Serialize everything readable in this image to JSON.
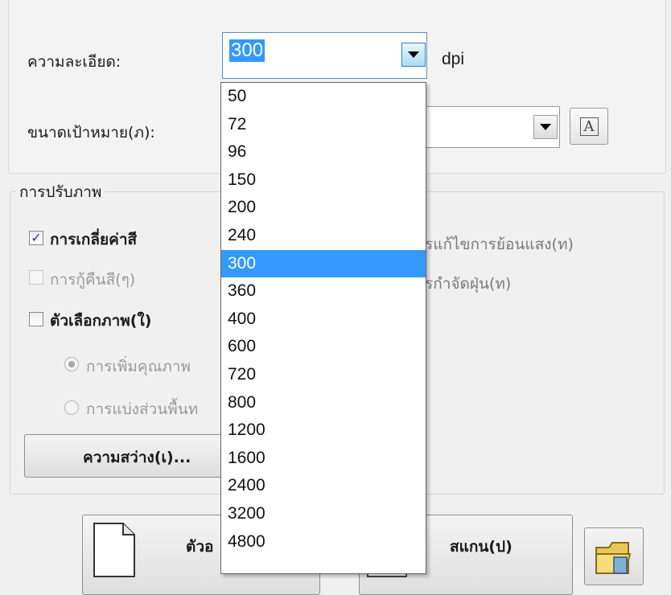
{
  "resolution": {
    "label": "ความละเอียด:",
    "value": "300",
    "unit": "dpi",
    "options": [
      "50",
      "72",
      "96",
      "150",
      "200",
      "240",
      "300",
      "360",
      "400",
      "600",
      "720",
      "800",
      "1200",
      "1600",
      "2400",
      "3200",
      "4800"
    ],
    "selected_option": "300"
  },
  "target_size": {
    "label": "ขนาดเป้าหมาย(ภ):",
    "value": "",
    "font_button_glyph": "A"
  },
  "adjustments": {
    "title": "การปรับภาพ",
    "color_smoothing": {
      "label": "การเกลี่ยค่าสี",
      "checked": true
    },
    "color_restore": {
      "label": "การกู้คืนสี(ๆ)",
      "enabled": false
    },
    "image_options": {
      "label": "ตัวเลือกภาพ(ใ)",
      "checked": false
    },
    "backlight_fix": {
      "label": "รแก้ไขการย้อนแสง(ท)"
    },
    "dust_removal": {
      "label": "รกำจัดฝุ่น(ท)"
    },
    "enhance_radio": {
      "label": "การเพิ่มคุณภาพ"
    },
    "segment_radio": {
      "label": "การแบ่งส่วนพื้นท"
    },
    "brightness_button": "ความสว่าง(เ)..."
  },
  "actions": {
    "preview_label": "ตัวอ",
    "scan_label": "สแกน(ป)"
  },
  "colors": {
    "selection": "#3399ff",
    "panel": "#f0f0f0"
  }
}
